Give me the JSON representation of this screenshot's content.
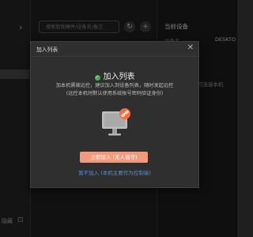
{
  "sidebar": {
    "bottom_label": "隐藏"
  },
  "search": {
    "placeholder": "搜索智能硬件/设备名/备注"
  },
  "buttons": {
    "refresh": "↻",
    "add": "+"
  },
  "right_panel": {
    "title": "当前设备",
    "device_label": "设备名",
    "device_value": "DESKTO",
    "hint": "可连接本机"
  },
  "dialog": {
    "title": "加入列表",
    "close": "✕",
    "heading": "加入列表",
    "desc_line1": "加本机需被远控，建议加入到设备列表，随时发起远控",
    "desc_line2": "(远控本机时默认使用系统帐号密码验证身份)",
    "primary_button": "立即加入 (无人值守)",
    "secondary_link": "暂不加入 (本机主要作为控制端)"
  },
  "colors": {
    "accent": "#f39a7a",
    "link": "#4a90e2",
    "success": "#4caf50",
    "chain_badge": "#ff6a3d"
  },
  "icons": [
    "chevron-right-icon",
    "lock-icon",
    "refresh-icon",
    "plus-icon",
    "close-icon",
    "check-circle-icon",
    "monitor-link-icon"
  ]
}
